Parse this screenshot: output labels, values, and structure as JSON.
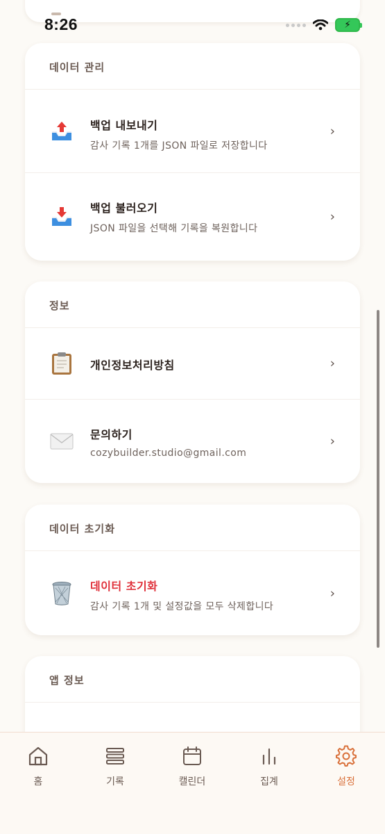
{
  "status": {
    "time": "8:26"
  },
  "sections": {
    "data_management": {
      "title": "데이터 관리",
      "export": {
        "title": "백업 내보내기",
        "subtitle": "감사 기록 1개를 JSON 파일로 저장합니다"
      },
      "import": {
        "title": "백업 불러오기",
        "subtitle": "JSON 파일을 선택해 기록을 복원합니다"
      }
    },
    "info": {
      "title": "정보",
      "privacy": {
        "title": "개인정보처리방침"
      },
      "contact": {
        "title": "문의하기",
        "subtitle": "cozybuilder.studio@gmail.com"
      }
    },
    "reset": {
      "title": "데이터 초기화",
      "reset_item": {
        "title": "데이터 초기화",
        "subtitle": "감사 기록 1개 및 설정값을 모두 삭제합니다"
      }
    },
    "app_info": {
      "title": "앱 정보"
    }
  },
  "tabs": [
    {
      "label": "홈",
      "icon": "home-icon"
    },
    {
      "label": "기록",
      "icon": "list-icon"
    },
    {
      "label": "캘린더",
      "icon": "calendar-icon"
    },
    {
      "label": "집계",
      "icon": "chart-icon"
    },
    {
      "label": "설정",
      "icon": "gear-icon",
      "active": true
    }
  ],
  "colors": {
    "accent": "#d9703a",
    "danger": "#e0303a",
    "background": "#FCFAF6"
  }
}
